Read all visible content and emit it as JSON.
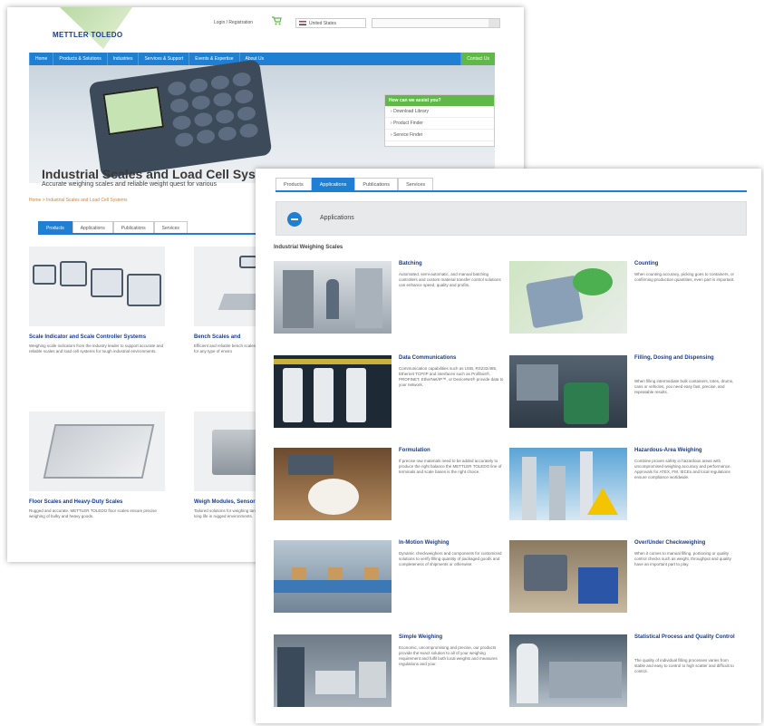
{
  "back": {
    "logo": "METTLER TOLEDO",
    "top_links": "Login / Registration",
    "country": "United States",
    "nav": [
      "Home",
      "Products & Solutions",
      "Industries",
      "Services & Support",
      "Events & Expertise",
      "About Us",
      "Contact Us"
    ],
    "help_box": {
      "title": "How can we assist you?",
      "items": [
        "Download Library",
        "Product Finder",
        "Service Finder"
      ]
    },
    "hero_title": "Industrial Scales and Load Cell Systems",
    "hero_subtitle": "Accurate weighing scales and reliable weight quest for various",
    "breadcrumb": "Home > Industrial Scales and Load Cell Systems",
    "tabs": [
      "Products",
      "Applications",
      "Publications",
      "Services"
    ],
    "cards": [
      {
        "title": "Scale Indicator and Scale Controller Systems",
        "desc": "Weighing scale indicators from the industry leader to support accurate and reliable scales and load cell systems for tough industrial environments."
      },
      {
        "title": "Bench Scales and",
        "desc": "Efficient and reliable bench scales, quality bench scales provide a solution for any type of enviro"
      },
      {
        "title": "Floor Scales and Heavy-Duty Scales",
        "desc": "Rugged and accurate. METTLER TOLEDO floor scales ensure precise weighing of bulky and heavy goods."
      },
      {
        "title": "Weigh Modules, Sensors",
        "desc": "Tailored solutions for weighing tanks by industry, regulatory and application long life in rugged environments."
      }
    ]
  },
  "front": {
    "tabs": [
      "Products",
      "Applications",
      "Publications",
      "Services"
    ],
    "header": "Applications",
    "section": "Industrial Weighing Scales",
    "apps": [
      {
        "title": "Batching",
        "desc": "Automated, semi-automatic, and manual batching controllers and custom material transfer control solutions can enhance speed, quality and profits."
      },
      {
        "title": "Counting",
        "desc": "When counting accuracy, picking goes to containers, or confirming production quantities, even part is important."
      },
      {
        "title": "Data Communications",
        "desc": "Communication capabilities such as USB, RS232/485, Ethernet TCP/IP and interfaces such as Profibus®, PROFINET, EtherNet/IP™, or DeviceNet® provide data to your network."
      },
      {
        "title": "Filling, Dosing and Dispensing",
        "desc": "When filling intermediate bulk containers, totes, drums, cans or vehicles, you need easy fast, precise, and repeatable results."
      },
      {
        "title": "Formulation",
        "desc": "If precise raw materials need to be added accurately to produce the right balance the METTLER TOLEDO line of terminals and scale bases is the right choice."
      },
      {
        "title": "Hazardous-Area Weighing",
        "desc": "Combine proven safety in hazardous areas with uncompromised weighing accuracy and performance. Approvals for ATEX, FM, IECEx and local regulations ensure compliance worldwide."
      },
      {
        "title": "In-Motion Weighing",
        "desc": "Dynamic checkweighers and components for customized solutions to verify filling quantity of packaged goods and completeness of shipments or otherwise."
      },
      {
        "title": "Over/Under Checkweighing",
        "desc": "When it comes to manual filling, portioning or quality control checks such as weight, throughput and quality have an important part to play."
      },
      {
        "title": "Simple Weighing",
        "desc": "Economic, uncompromising and precise, our products provide the exact solution to all of your weighing requirement and fulfil both local weights and measures regulations and your."
      },
      {
        "title": "Statistical Process and Quality Control",
        "desc": "The quality of individual filling processes varies from stable and easy to control to high scatter and difficult to control."
      }
    ]
  },
  "colors": {
    "brand_blue": "#1f7fd2",
    "accent_green": "#5fb848",
    "title_navy": "#1a3d8f"
  }
}
